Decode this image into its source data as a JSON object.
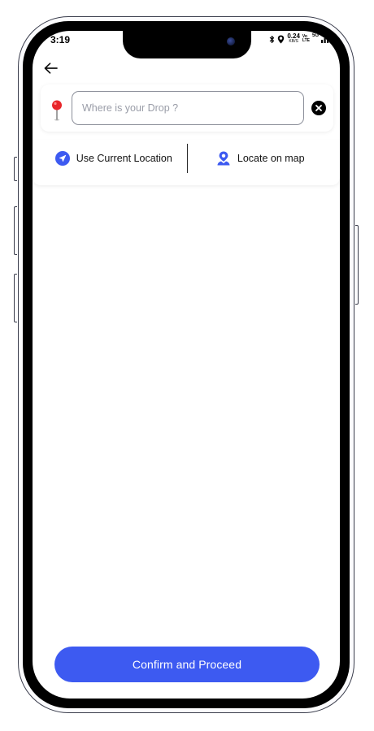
{
  "status_bar": {
    "time": "3:19",
    "net_speed": "0.24",
    "net_unit": "KB/S",
    "volte_top": "Vo",
    "volte_bottom": "LTE",
    "network_type": "5G",
    "icons": [
      "bluetooth-icon",
      "location-icon",
      "signal-icon",
      "battery-icon"
    ],
    "battery_color": "#27c23f"
  },
  "header": {
    "back_icon": "arrow-left-icon"
  },
  "search": {
    "placeholder": "Where is your Drop ?",
    "value": "",
    "pin_icon": "red-map-pin-icon",
    "clear_icon": "close-circle-icon"
  },
  "options": {
    "current_location_label": "Use Current Location",
    "current_location_icon": "navigation-arrow-icon",
    "locate_map_label": "Locate on map",
    "locate_map_icon": "map-marker-person-icon"
  },
  "footer": {
    "confirm_label": "Confirm and Proceed"
  },
  "colors": {
    "accent": "#3d5af1",
    "pin_red": "#e8262a"
  }
}
